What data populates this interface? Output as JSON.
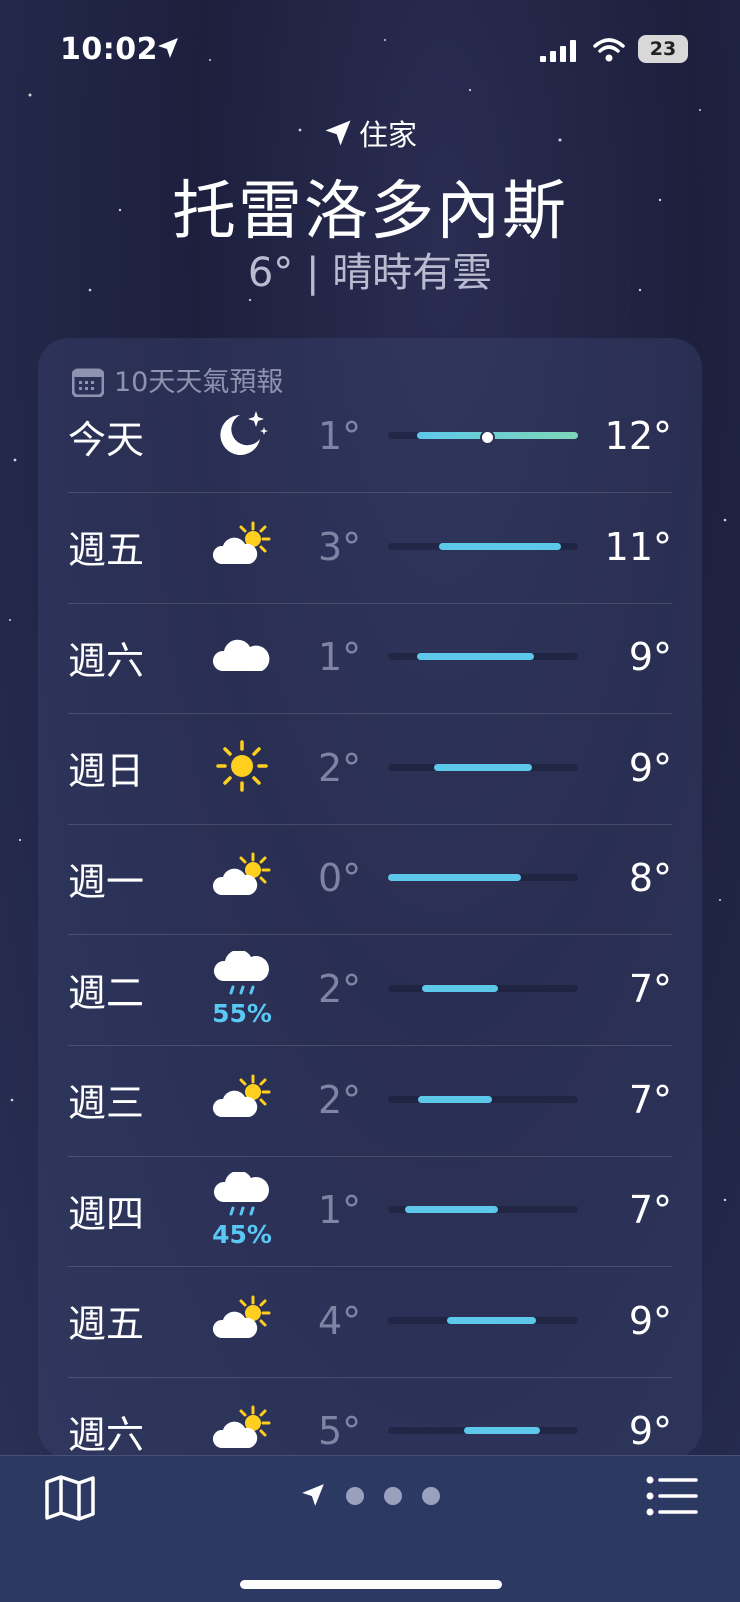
{
  "status_bar": {
    "time": "10:02",
    "battery": "23"
  },
  "header": {
    "location_label": "住家",
    "city": "托雷洛多內斯",
    "current_temp": "6°",
    "condition": "晴時有雲"
  },
  "forecast": {
    "title": "10天天氣預報",
    "days": [
      {
        "day": "今天",
        "icon": "moon-stars-icon",
        "precip": "",
        "low": "1°",
        "high": "12°",
        "bar_start": 0.15,
        "bar_end": 1.0,
        "current": 0.52
      },
      {
        "day": "週五",
        "icon": "partly-sunny-icon",
        "precip": "",
        "low": "3°",
        "high": "11°",
        "bar_start": 0.27,
        "bar_end": 0.91
      },
      {
        "day": "週六",
        "icon": "cloud-icon",
        "precip": "",
        "low": "1°",
        "high": "9°",
        "bar_start": 0.15,
        "bar_end": 0.77
      },
      {
        "day": "週日",
        "icon": "sun-icon",
        "precip": "",
        "low": "2°",
        "high": "9°",
        "bar_start": 0.24,
        "bar_end": 0.76
      },
      {
        "day": "週一",
        "icon": "partly-sunny-icon",
        "precip": "",
        "low": "0°",
        "high": "8°",
        "bar_start": 0.0,
        "bar_end": 0.7
      },
      {
        "day": "週二",
        "icon": "rain-icon",
        "precip": "55%",
        "low": "2°",
        "high": "7°",
        "bar_start": 0.18,
        "bar_end": 0.58
      },
      {
        "day": "週三",
        "icon": "partly-sunny-icon",
        "precip": "",
        "low": "2°",
        "high": "7°",
        "bar_start": 0.16,
        "bar_end": 0.55
      },
      {
        "day": "週四",
        "icon": "rain-icon",
        "precip": "45%",
        "low": "1°",
        "high": "7°",
        "bar_start": 0.09,
        "bar_end": 0.58
      },
      {
        "day": "週五",
        "icon": "partly-sunny-icon",
        "precip": "",
        "low": "4°",
        "high": "9°",
        "bar_start": 0.31,
        "bar_end": 0.78
      },
      {
        "day": "週六",
        "icon": "partly-sunny-icon",
        "precip": "",
        "low": "5°",
        "high": "9°",
        "bar_start": 0.4,
        "bar_end": 0.8
      }
    ]
  },
  "toolbar": {
    "pages": 3
  },
  "colors": {
    "bar_fill": "#5ec8ea",
    "precip": "#59c8f5",
    "sun": "#ffcf1f"
  }
}
